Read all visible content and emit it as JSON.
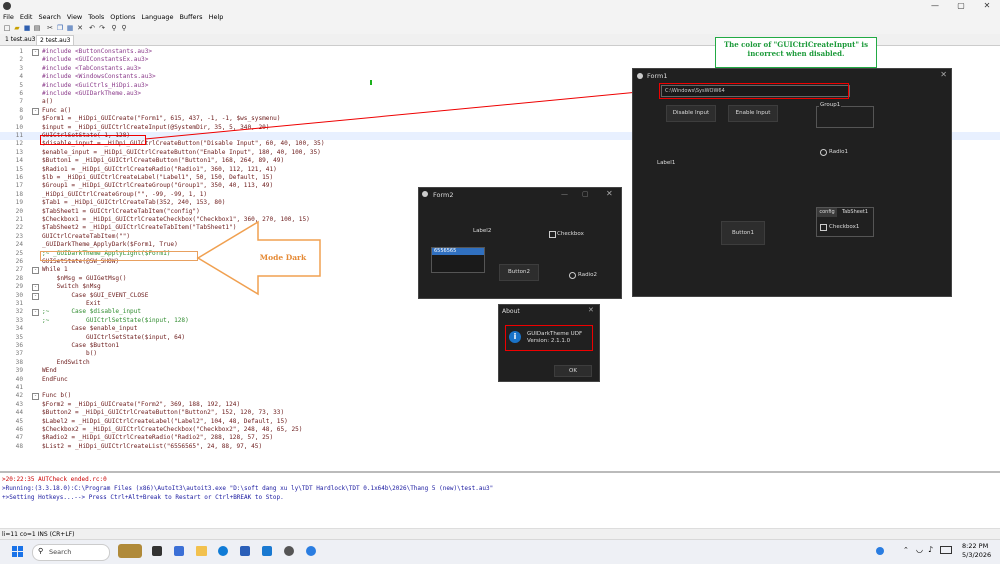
{
  "window": {
    "min": "—",
    "max": "▢",
    "close": "✕"
  },
  "menu": [
    "File",
    "Edit",
    "Search",
    "View",
    "Tools",
    "Options",
    "Language",
    "Buffers",
    "Help"
  ],
  "tabs": [
    "1 test.au3",
    "2 test.au3"
  ],
  "code": [
    {
      "n": "1",
      "t": "#include <ButtonConstants.au3>",
      "f": "-"
    },
    {
      "n": "2",
      "t": "#include <GUIConstantsEx.au3>",
      "f": ""
    },
    {
      "n": "3",
      "t": "#include <TabConstants.au3>",
      "f": ""
    },
    {
      "n": "4",
      "t": "#include <WindowsConstants.au3>",
      "f": ""
    },
    {
      "n": "5",
      "t": "#include <GuiCtrls_HiDpi.au3>",
      "f": ""
    },
    {
      "n": "6",
      "t": "#include <GUIDarkTheme.au3>",
      "f": ""
    },
    {
      "n": "7",
      "t": "a()",
      "f": ""
    },
    {
      "n": "8",
      "t": "Func a()",
      "f": "-"
    },
    {
      "n": "9",
      "t": "$Form1 = _HiDpi_GUICreate(\"Form1\", 615, 437, -1, -1, $ws_sysmenu)",
      "f": ""
    },
    {
      "n": "10",
      "t": "$input = _HiDpi_GUICtrlCreateInput(@SystemDir, 35, 5, 340, 20)",
      "f": ""
    },
    {
      "n": "11",
      "t": "GUICtrlSetState(-1, 128)",
      "f": ""
    },
    {
      "n": "12",
      "t": "$disable_input = _HiDpi_GUICtrlCreateButton(\"Disable Input\", 60, 40, 100, 35)",
      "f": ""
    },
    {
      "n": "13",
      "t": "$enable_input = _HiDpi_GUICtrlCreateButton(\"Enable Input\", 180, 40, 100, 35)",
      "f": ""
    },
    {
      "n": "14",
      "t": "$Button1 = _HiDpi_GUICtrlCreateButton(\"Button1\", 168, 264, 89, 49)",
      "f": ""
    },
    {
      "n": "15",
      "t": "$Radio1 = _HiDpi_GUICtrlCreateRadio(\"Radio1\", 360, 112, 121, 41)",
      "f": ""
    },
    {
      "n": "16",
      "t": "$lb = _HiDpi_GUICtrlCreateLabel(\"Label1\", 50, 150, Default, 15)",
      "f": ""
    },
    {
      "n": "17",
      "t": "$Group1 = _HiDpi_GUICtrlCreateGroup(\"Group1\", 350, 40, 113, 49)",
      "f": ""
    },
    {
      "n": "18",
      "t": "_HiDpi_GUICtrlCreateGroup(\"\", -99, -99, 1, 1)",
      "f": ""
    },
    {
      "n": "19",
      "t": "$Tab1 = _HiDpi_GUICtrlCreateTab(352, 240, 153, 80)",
      "f": ""
    },
    {
      "n": "20",
      "t": "$TabSheet1 = GUICtrlCreateTabItem(\"config\")",
      "f": ""
    },
    {
      "n": "21",
      "t": "$Checkbox1 = _HiDpi_GUICtrlCreateCheckbox(\"Checkbox1\", 360, 270, 100, 15)",
      "f": ""
    },
    {
      "n": "22",
      "t": "$TabSheet2 = _HiDpi_GUICtrlCreateTabItem(\"TabSheet1\")",
      "f": ""
    },
    {
      "n": "23",
      "t": "GUICtrlCreateTabItem(\"\")",
      "f": ""
    },
    {
      "n": "24",
      "t": "_GUIDarkTheme_ApplyDark($Form1, True)",
      "f": ""
    },
    {
      "n": "25",
      "t": ";~ _GUIDarkTheme_ApplyLight($Form1)",
      "f": ""
    },
    {
      "n": "26",
      "t": "GUISetState(@SW_SHOW)",
      "f": ""
    },
    {
      "n": "27",
      "t": "While 1",
      "f": "-"
    },
    {
      "n": "28",
      "t": "    $nMsg = GUIGetMsg()",
      "f": ""
    },
    {
      "n": "29",
      "t": "    Switch $nMsg",
      "f": "-"
    },
    {
      "n": "30",
      "t": "        Case $GUI_EVENT_CLOSE",
      "f": "-"
    },
    {
      "n": "31",
      "t": "            Exit",
      "f": ""
    },
    {
      "n": "32",
      "t": ";~      Case $disable_input",
      "f": "-"
    },
    {
      "n": "33",
      "t": ";~          GUICtrlSetState($input, 128)",
      "f": ""
    },
    {
      "n": "34",
      "t": "        Case $enable_input",
      "f": ""
    },
    {
      "n": "35",
      "t": "            GUICtrlSetState($input, 64)",
      "f": ""
    },
    {
      "n": "36",
      "t": "        Case $Button1",
      "f": ""
    },
    {
      "n": "37",
      "t": "            b()",
      "f": ""
    },
    {
      "n": "38",
      "t": "    EndSwitch",
      "f": ""
    },
    {
      "n": "39",
      "t": "WEnd",
      "f": ""
    },
    {
      "n": "40",
      "t": "EndFunc",
      "f": ""
    },
    {
      "n": "41",
      "t": "",
      "f": ""
    },
    {
      "n": "42",
      "t": "Func b()",
      "f": "-"
    },
    {
      "n": "43",
      "t": "$Form2 = _HiDpi_GUICreate(\"Form2\", 369, 188, 192, 124)",
      "f": ""
    },
    {
      "n": "44",
      "t": "$Button2 = _HiDpi_GUICtrlCreateButton(\"Button2\", 152, 120, 73, 33)",
      "f": ""
    },
    {
      "n": "45",
      "t": "$Label2 = _HiDpi_GUICtrlCreateLabel(\"Label2\", 104, 48, Default, 15)",
      "f": ""
    },
    {
      "n": "46",
      "t": "$Checkbox2 = _HiDpi_GUICtrlCreateCheckbox(\"Checkbox2\", 248, 48, 65, 25)",
      "f": ""
    },
    {
      "n": "47",
      "t": "$Radio2 = _HiDpi_GUICtrlCreateRadio(\"Radio2\", 288, 128, 57, 25)",
      "f": ""
    },
    {
      "n": "48",
      "t": "$List2 = _HiDpi_GUICtrlCreateList(\"6556565\", 24, 88, 97, 45)",
      "f": ""
    }
  ],
  "output": [
    ">20:22:35 AUTCheck ended.rc:0",
    ">Running:(3.3.18.0):C:\\Program Files (x86)\\AutoIt3\\autoit3.exe \"D:\\soft dang xu ly\\TDT Hardlock\\TDT 0.1x64b\\2026\\Thang 5 (new)\\test.au3\"",
    "+>Setting Hotkeys...--> Press Ctrl+Alt+Break to Restart or Ctrl+BREAK to Stop."
  ],
  "status": "li=11 co=1 INS (CR+LF)",
  "callout": "The color of \"GUICtrlCreateInput\" is incorrect when disabled.",
  "mode_dark": "Mode Dark",
  "form1": {
    "title": "Form1",
    "input": "C:\\Windows\\SysWOW64",
    "disable": "Disable Input",
    "enable": "Enable Input",
    "group": "Group1",
    "radio": "Radio1",
    "label": "Label1",
    "button": "Button1",
    "tab1": "config",
    "tab2": "TabSheet1",
    "checkbox": "Checkbox1"
  },
  "form2": {
    "title": "Form2",
    "label": "Label2",
    "checkbox": "Checkbox",
    "list": "6556565",
    "button": "Button2",
    "radio": "Radio2"
  },
  "about": {
    "title": "About",
    "name": "GUIDarkTheme UDF",
    "version": "Version:  2.1.1.0",
    "ok": "OK"
  },
  "taskbar": {
    "search": "Search",
    "time": "8:22 PM",
    "date": "5/3/2026"
  }
}
